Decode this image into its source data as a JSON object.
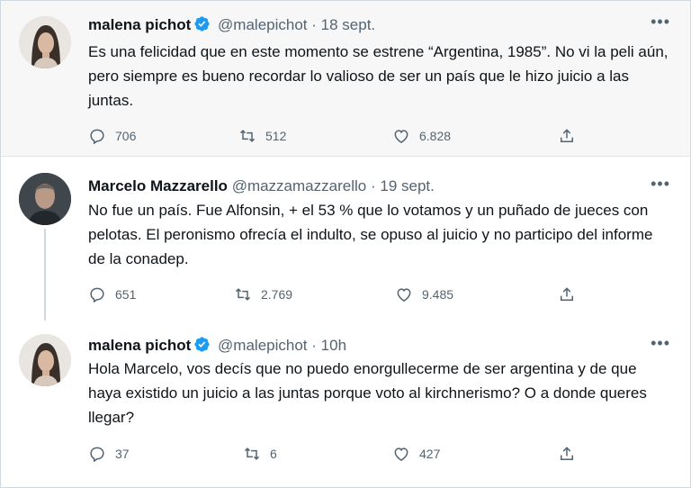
{
  "tweets": [
    {
      "name": "malena pichot",
      "verified": true,
      "handle": "@malepichot",
      "separator": "·",
      "date": "18 sept.",
      "text": "Es una felicidad que en este momento se estrene “Argentina, 1985”. No vi la peli aún, pero siempre es bueno recordar lo valioso de ser un país que le hizo juicio a las juntas.",
      "replies": "706",
      "retweets": "512",
      "likes": "6.828"
    },
    {
      "name": "Marcelo Mazzarello",
      "verified": false,
      "handle": "@mazzamazzarello",
      "separator": "·",
      "date": "19 sept.",
      "text": "No fue un país. Fue Alfonsin, + el 53 % que lo votamos  y un puñado de jueces con pelotas. El peronismo ofrecía el indulto, se opuso al juicio  y no participo del informe de la conadep.",
      "replies": "651",
      "retweets": "2.769",
      "likes": "9.485"
    },
    {
      "name": "malena pichot",
      "verified": true,
      "handle": "@malepichot",
      "separator": "·",
      "date": "10h",
      "text": "Hola Marcelo, vos decís que no puedo enorgullecerme de ser argentina y de que haya existido un juicio a las juntas porque voto al kirchnerismo? O a donde queres llegar?",
      "replies": "37",
      "retweets": "6",
      "likes": "427"
    }
  ],
  "more_glyph": "•••",
  "colors": {
    "verified": "#1d9bf0",
    "muted": "#536471",
    "text": "#0f1419",
    "thread": "#cfd9de"
  },
  "icons": [
    "reply-icon",
    "retweet-icon",
    "like-icon",
    "share-icon",
    "verified-badge-icon",
    "more-icon"
  ]
}
